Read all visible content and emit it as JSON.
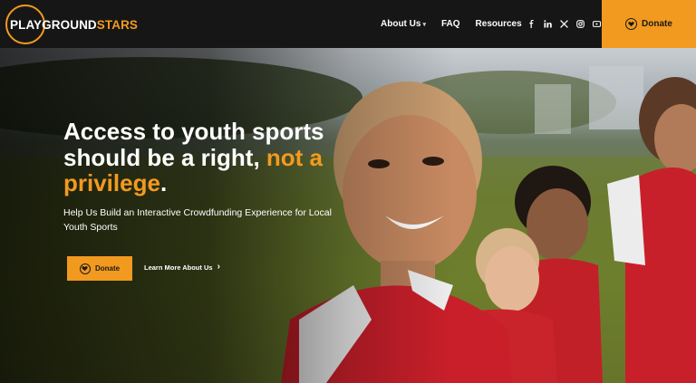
{
  "header": {
    "logo": {
      "part1": "PLAYGROUND",
      "part2": "STARS"
    },
    "nav": [
      {
        "label": "About Us",
        "has_dropdown": true
      },
      {
        "label": "FAQ",
        "has_dropdown": false
      },
      {
        "label": "Resources",
        "has_dropdown": false
      }
    ],
    "socials": [
      "facebook-icon",
      "linkedin-icon",
      "x-icon",
      "instagram-icon",
      "youtube-icon"
    ],
    "donate_label": "Donate"
  },
  "hero": {
    "headline_part1": "Access to youth sports should be a right, ",
    "headline_highlight": "not a privilege",
    "headline_end": ".",
    "subtext": "Help Us Build an Interactive Crowdfunding Experience for Local Youth Sports",
    "donate_label": "Donate",
    "learn_more_label": "Learn More About Us"
  },
  "colors": {
    "accent": "#f29a1f",
    "header_bg": "#161616",
    "text": "#ffffff"
  }
}
